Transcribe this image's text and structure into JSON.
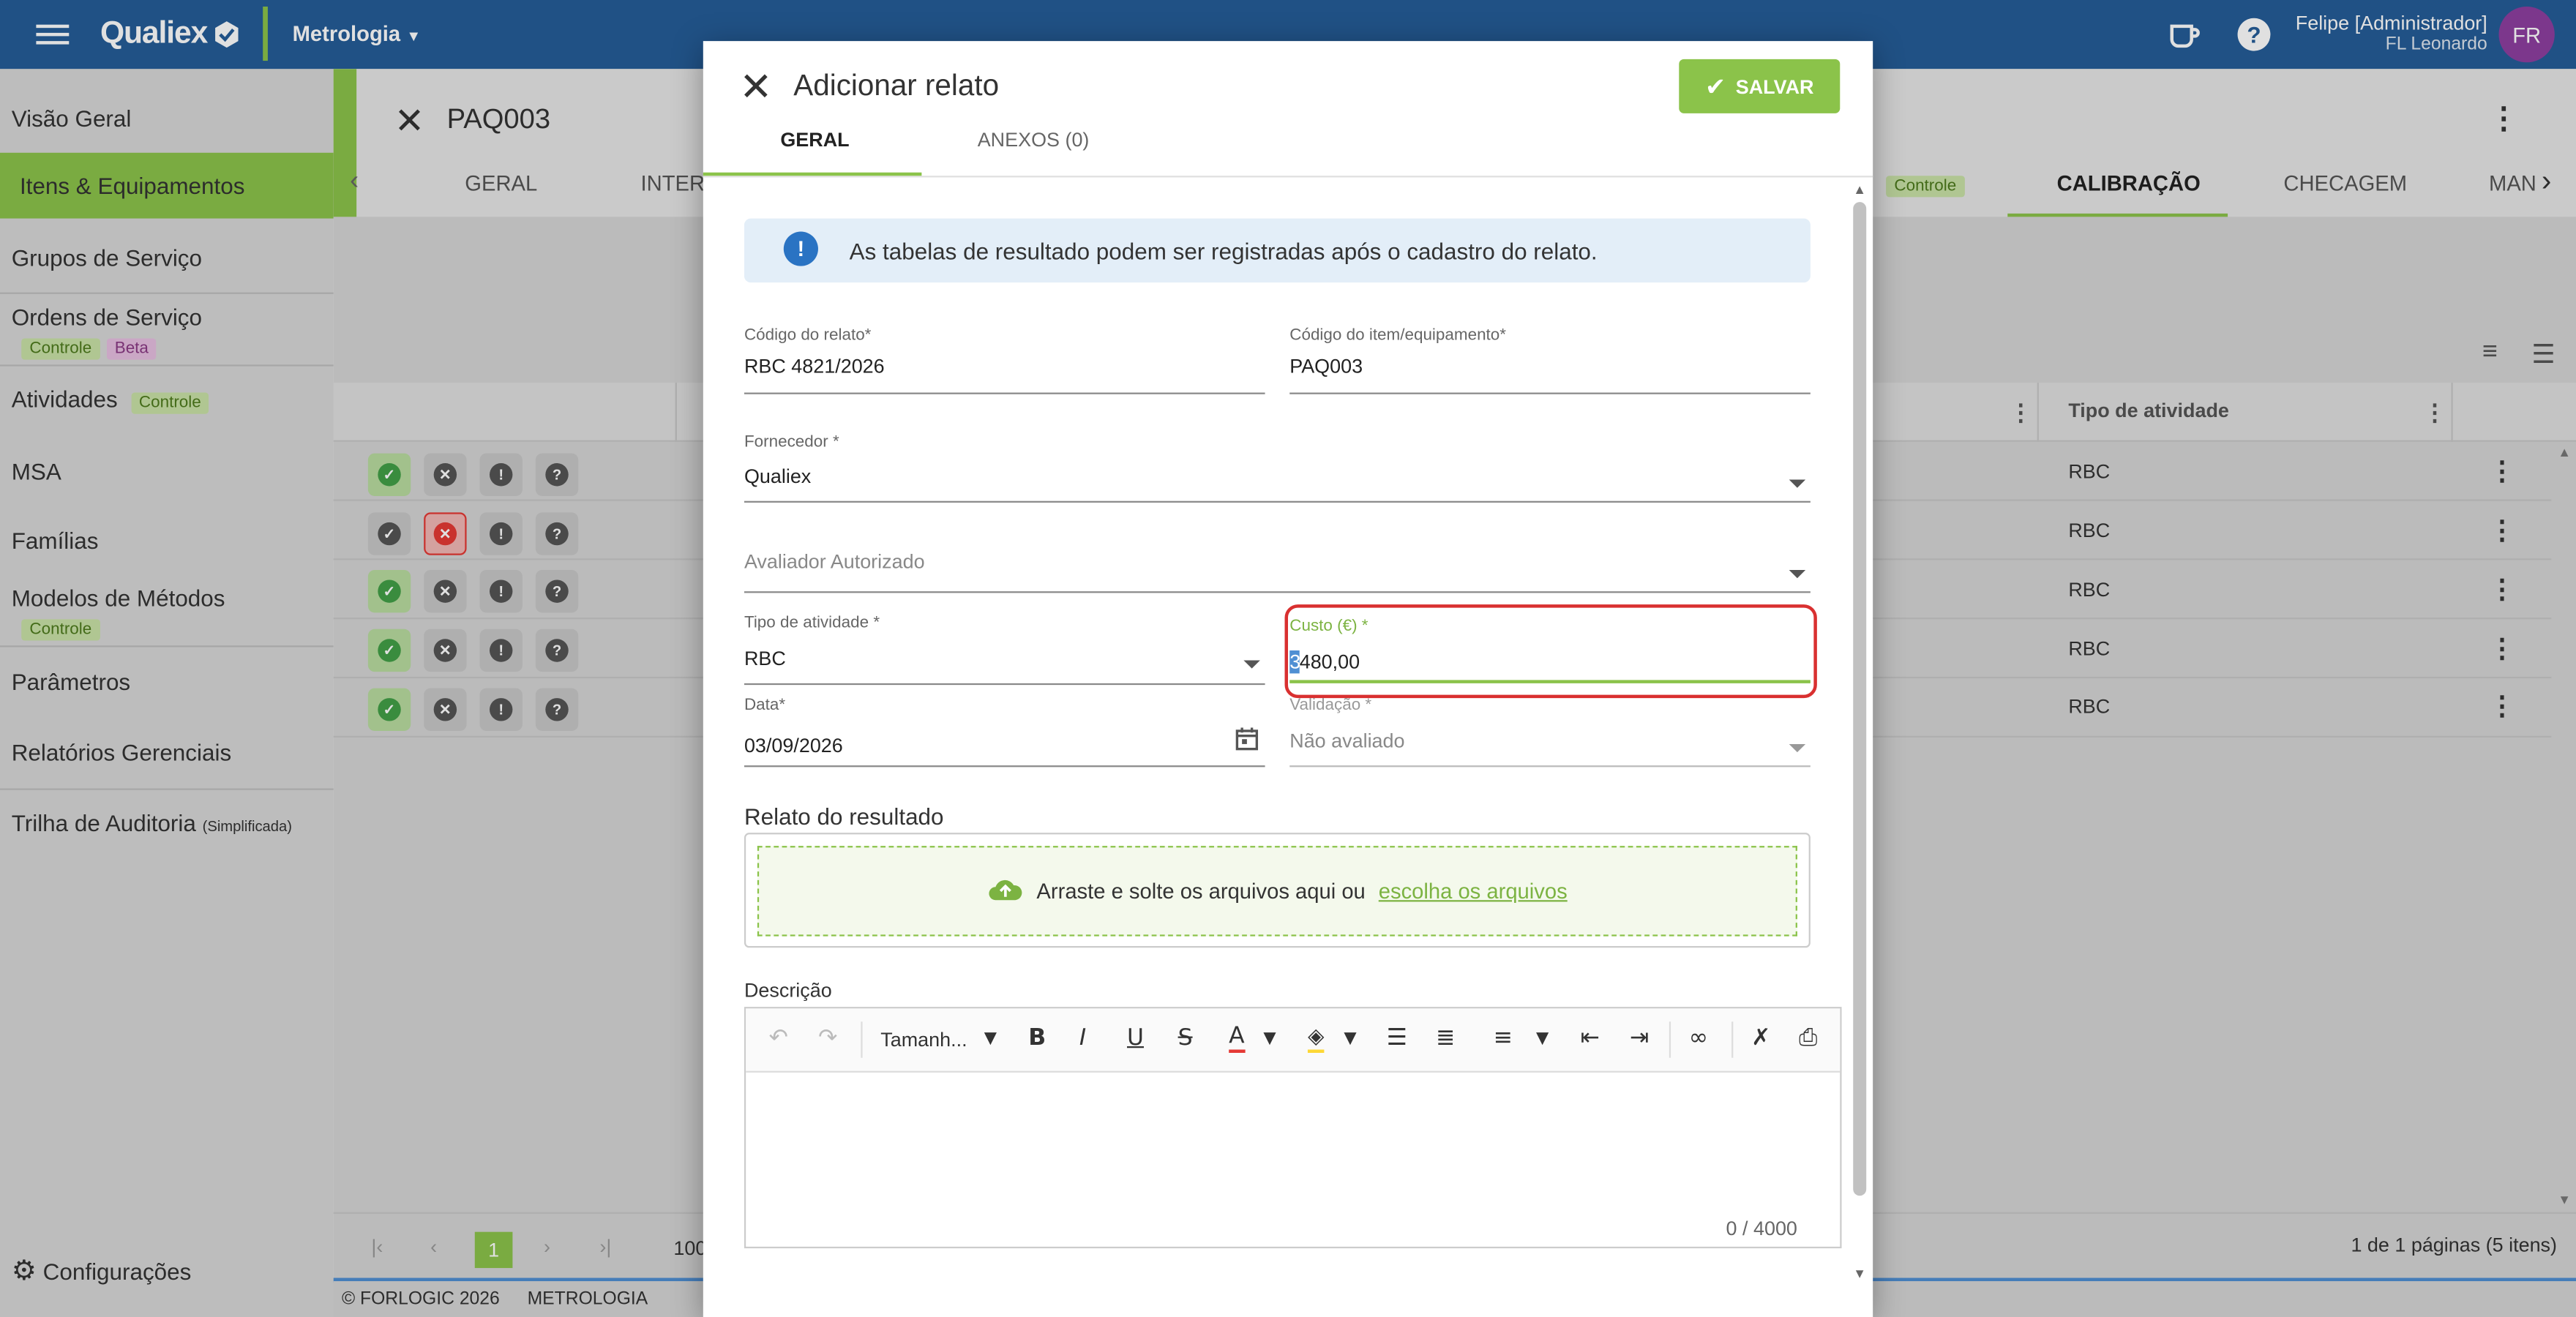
{
  "topbar": {
    "brand": "Qualiex",
    "module": "Metrologia",
    "user_name": "Felipe [Administrador]",
    "user_sub": "FL Leonardo",
    "avatar_initials": "FR"
  },
  "sidebar": {
    "items": [
      {
        "label": "Visão Geral"
      },
      {
        "label": "Itens & Equipamentos"
      },
      {
        "label": "Grupos de Serviço"
      },
      {
        "label": "Ordens de Serviço",
        "badges": [
          "Controle",
          "Beta"
        ]
      },
      {
        "label": "Atividades",
        "badges": [
          "Controle"
        ]
      },
      {
        "label": "MSA"
      },
      {
        "label": "Famílias"
      },
      {
        "label": "Modelos de Métodos",
        "badges": [
          "Controle"
        ]
      },
      {
        "label": "Parâmetros"
      },
      {
        "label": "Relatórios Gerenciais"
      },
      {
        "label": "Trilha de Auditoria",
        "suffix": "(Simplificada)"
      }
    ],
    "settings_label": "Configurações"
  },
  "background_page": {
    "title": "PAQ003",
    "tabs": [
      "GERAL",
      "INTERV",
      "Controle",
      "CALIBRAÇÃO",
      "CHECAGEM",
      "MAN"
    ],
    "active_tab": "CALIBRAÇÃO",
    "column_header": "Tipo de atividade",
    "rows": [
      "RBC",
      "RBC",
      "RBC",
      "RBC",
      "RBC"
    ],
    "pagination": {
      "current_page": "1",
      "page_size": "100",
      "summary": "1 de 1 páginas (5 itens)"
    },
    "footer_left": "© FORLOGIC 2026",
    "footer_right": "METROLOGIA"
  },
  "modal": {
    "title": "Adicionar relato",
    "save_label": "SALVAR",
    "tabs": [
      {
        "label": "GERAL"
      },
      {
        "label": "ANEXOS (0)"
      }
    ],
    "info_text": "As tabelas de resultado podem ser registradas após o cadastro do relato.",
    "fields": {
      "codigo_relato": {
        "label": "Código do relato*",
        "value": "RBC 4821/2026"
      },
      "codigo_item": {
        "label": "Código do item/equipamento*",
        "value": "PAQ003"
      },
      "fornecedor": {
        "label": "Fornecedor *",
        "value": "Qualiex"
      },
      "avaliador": {
        "label": "",
        "placeholder": "Avaliador Autorizado"
      },
      "tipo_atividade": {
        "label": "Tipo de atividade *",
        "value": "RBC"
      },
      "custo": {
        "label": "Custo (€) *",
        "value_selected": "3",
        "value_rest": "480,00"
      },
      "data": {
        "label": "Data*",
        "value": "03/09/2026"
      },
      "validacao": {
        "label": "Validação *",
        "value": "Não avaliado"
      }
    },
    "relato_section": "Relato do resultado",
    "dropzone_text": "Arraste e solte os arquivos aqui ou",
    "dropzone_link": "escolha os arquivos",
    "descricao_label": "Descrição",
    "editor": {
      "font_size_label": "Tamanh...",
      "counter": "0 / 4000"
    }
  },
  "colors": {
    "header_blue": "#255d98",
    "accent_green": "#8bc34a",
    "highlight_red": "#d93030"
  }
}
